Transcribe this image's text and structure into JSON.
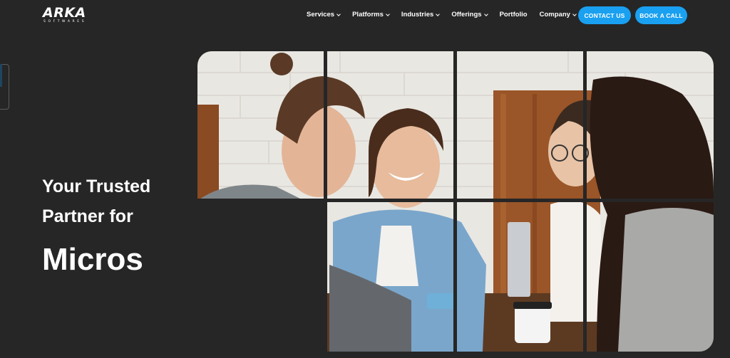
{
  "brand": {
    "name": "ARKA",
    "tagline": "SOFTWARES"
  },
  "nav": {
    "items": [
      {
        "label": "Services",
        "dropdown": true
      },
      {
        "label": "Platforms",
        "dropdown": true
      },
      {
        "label": "Industries",
        "dropdown": true
      },
      {
        "label": "Offerings",
        "dropdown": true
      },
      {
        "label": "Portfolio",
        "dropdown": false
      },
      {
        "label": "Company",
        "dropdown": true
      }
    ]
  },
  "actions": {
    "contact": "CONTACT US",
    "book": "BOOK A CALL"
  },
  "hero": {
    "line1": "Your Trusted",
    "line2": "Partner for",
    "highlight": "Micros"
  },
  "colors": {
    "background": "#262626",
    "accent": "#1aa0f0",
    "text": "#ffffff"
  },
  "icons": {
    "dropdown": "chevron-down-icon",
    "logo": "arka-logo"
  }
}
